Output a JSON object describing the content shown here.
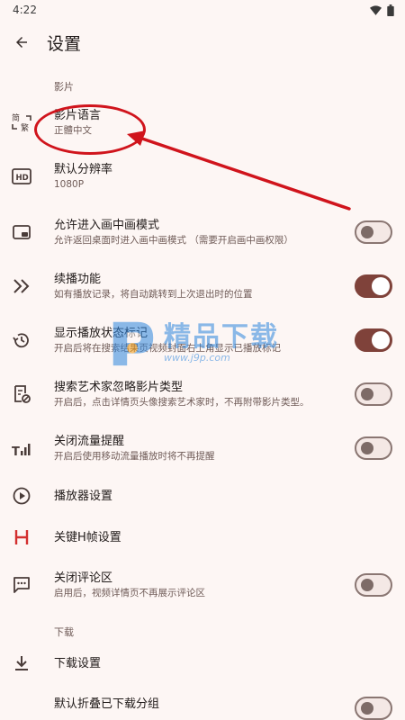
{
  "status_bar": {
    "time": "4:22"
  },
  "app_bar": {
    "title": "设置"
  },
  "sections": {
    "video": "影片",
    "download": "下载"
  },
  "items": {
    "language": {
      "title": "影片语言",
      "subtitle": "正體中文",
      "icon": "traditional-simplified-icon"
    },
    "resolution": {
      "title": "默认分辨率",
      "subtitle": "1080P",
      "icon": "hd-icon"
    },
    "pip": {
      "title": "允许进入画中画模式",
      "subtitle": "允许返回桌面时进入画中画模式 （需要开启画中画权限）",
      "icon": "picture-in-picture-icon",
      "enabled": false
    },
    "resume": {
      "title": "续播功能",
      "subtitle": "如有播放记录，将自动跳转到上次退出时的位置",
      "icon": "double-chevron-icon",
      "enabled": true
    },
    "play_status": {
      "title": "显示播放状态标记",
      "subtitle": "开启后将在搜索结果页视频封面右上角显示已播放标记",
      "icon": "history-icon",
      "enabled": true
    },
    "ignore_type": {
      "title": "搜索艺术家忽略影片类型",
      "subtitle": "开启后，点击详情页头像搜索艺术家时，不再附带影片类型。",
      "icon": "search-filter-icon",
      "enabled": false
    },
    "data_warning": {
      "title": "关闭流量提醒",
      "subtitle": "开启后使用移动流量播放时将不再提醒",
      "icon": "signal-icon",
      "enabled": false
    },
    "player": {
      "title": "播放器设置",
      "icon": "play-circle-icon"
    },
    "keyframe": {
      "title": "关键H帧设置",
      "icon": "h-letter-icon",
      "accent": "#d32f2f"
    },
    "comments": {
      "title": "关闭评论区",
      "subtitle": "启用后，视频详情页不再展示评论区",
      "icon": "comment-icon",
      "enabled": false
    },
    "download_settings": {
      "title": "下载设置",
      "icon": "download-icon"
    },
    "partial": {
      "title": "默认折叠已下载分组"
    }
  },
  "watermark": {
    "text": "精品下载",
    "url": "www.j9p.com"
  },
  "colors": {
    "background": "#fdf6f4",
    "toggle_on": "#7f423a",
    "annotation": "#d0141c"
  }
}
